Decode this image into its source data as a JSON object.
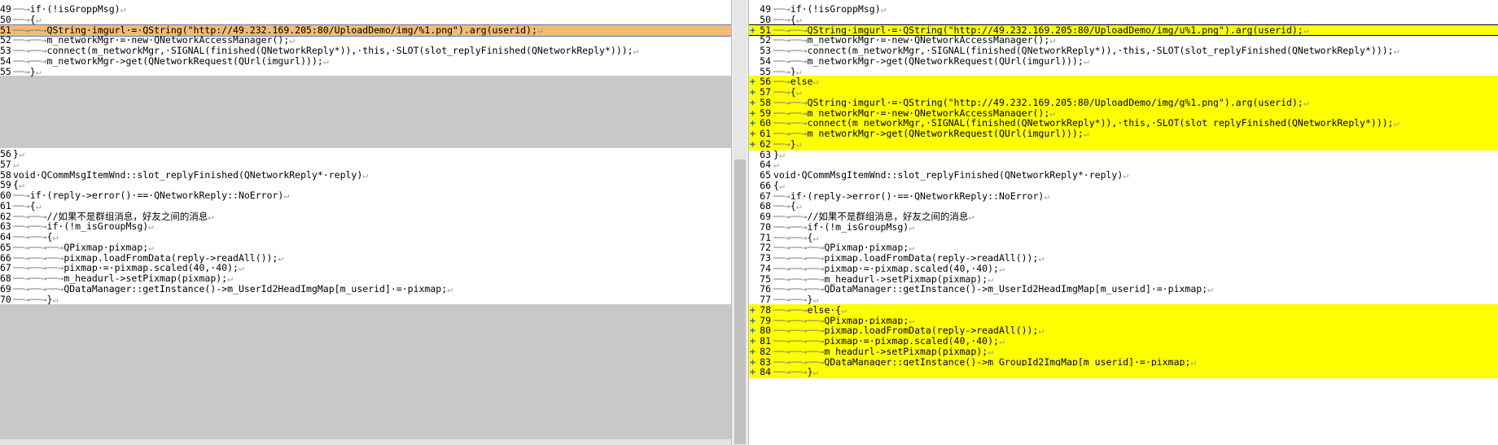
{
  "left_pane": {
    "lines": [
      {
        "num": "49",
        "fold": "──→",
        "code": "if·(!isGroppMsg)",
        "type": "normal"
      },
      {
        "num": "50",
        "fold": "──→",
        "code": "{",
        "type": "normal"
      },
      {
        "num": "51",
        "fold": "──→──→",
        "code": "QString·imgurl·=·QString(\"http://49.232.169.205:80/UploadDemo/img/%1.png\").arg(userid);",
        "type": "current"
      },
      {
        "num": "52",
        "fold": "──→──→",
        "code": "m_networkMgr·=·new·QNetworkAccessManager();",
        "type": "normal"
      },
      {
        "num": "53",
        "fold": "──→──→",
        "code": "connect(m_networkMgr,·SIGNAL(finished(QNetworkReply*)),·this,·SLOT(slot_replyFinished(QNetworkReply*)));",
        "type": "normal"
      },
      {
        "num": "54",
        "fold": "──→──→",
        "code": "m_networkMgr->get(QNetworkRequest(QUrl(imgurl)));",
        "type": "normal"
      },
      {
        "num": "55",
        "fold": "──→",
        "code": "}",
        "type": "normal"
      },
      {
        "num": "56",
        "fold": "",
        "code": "}",
        "type": "normal"
      },
      {
        "num": "57",
        "fold": "",
        "code": "",
        "type": "normal"
      },
      {
        "num": "58",
        "fold": "",
        "code": "void·QCommMsgItemWnd::slot_replyFinished(QNetworkReply*·reply)",
        "type": "normal"
      },
      {
        "num": "59",
        "fold": "",
        "code": "{",
        "type": "normal"
      },
      {
        "num": "60",
        "fold": "──→",
        "code": "if·(reply->error()·==·QNetworkReply::NoError)",
        "type": "normal"
      },
      {
        "num": "61",
        "fold": "──→",
        "code": "{",
        "type": "normal"
      },
      {
        "num": "62",
        "fold": "──→──→",
        "code": "//如果不是群组消息，好友之间的消息",
        "type": "normal"
      },
      {
        "num": "63",
        "fold": "──→──→",
        "code": "if·(!m_isGroupMsg)",
        "type": "normal"
      },
      {
        "num": "64",
        "fold": "──→──→",
        "code": "{",
        "type": "normal"
      },
      {
        "num": "65",
        "fold": "──→──→──→",
        "code": "QPixmap·pixmap;",
        "type": "normal"
      },
      {
        "num": "66",
        "fold": "──→──→──→",
        "code": "pixmap.loadFromData(reply->readAll());",
        "type": "normal"
      },
      {
        "num": "67",
        "fold": "──→──→──→",
        "code": "pixmap·=·pixmap.scaled(40,·40);",
        "type": "normal"
      },
      {
        "num": "68",
        "fold": "──→──→──→",
        "code": "m_headurl->setPixmap(pixmap);",
        "type": "normal"
      },
      {
        "num": "69",
        "fold": "──→──→──→",
        "code": "QDataManager::getInstance()->m_UserId2HeadImgMap[m_userid]·=·pixmap;",
        "type": "normal"
      },
      {
        "num": "70",
        "fold": "──→──→",
        "code": "}",
        "type": "normal"
      }
    ]
  },
  "right_pane": {
    "lines": [
      {
        "num": "49",
        "fold": "──→",
        "code": "if·(!isGroppMsg)",
        "type": "normal",
        "marker": ""
      },
      {
        "num": "50",
        "fold": "──→",
        "code": "{",
        "type": "normal",
        "marker": ""
      },
      {
        "num": "51",
        "fold": "──→──→",
        "code": "QString·imgurl·=·QString(\"http://49.232.169.205:80/UploadDemo/img/u%1.png\").arg(userid);",
        "type": "current",
        "marker": "+"
      },
      {
        "num": "52",
        "fold": "──→──→",
        "code": "m_networkMgr·=·new·QNetworkAccessManager();",
        "type": "normal",
        "marker": ""
      },
      {
        "num": "53",
        "fold": "──→──→",
        "code": "connect(m_networkMgr,·SIGNAL(finished(QNetworkReply*)),·this,·SLOT(slot_replyFinished(QNetworkReply*)));",
        "type": "normal",
        "marker": ""
      },
      {
        "num": "54",
        "fold": "──→──→",
        "code": "m_networkMgr->get(QNetworkRequest(QUrl(imgurl)));",
        "type": "normal",
        "marker": ""
      },
      {
        "num": "55",
        "fold": "──→",
        "code": "}",
        "type": "normal",
        "marker": ""
      },
      {
        "num": "56",
        "fold": "──→",
        "code": "else",
        "type": "added",
        "marker": "+"
      },
      {
        "num": "57",
        "fold": "──→",
        "code": "{",
        "type": "added",
        "marker": "+"
      },
      {
        "num": "58",
        "fold": "──→──→",
        "code": "QString·imgurl·=·QString(\"http://49.232.169.205:80/UploadDemo/img/g%1.png\").arg(userid);",
        "type": "added",
        "marker": "+"
      },
      {
        "num": "59",
        "fold": "──→──→",
        "code": "m_networkMgr·=·new·QNetworkAccessManager();",
        "type": "added",
        "marker": "+"
      },
      {
        "num": "60",
        "fold": "──→──→",
        "code": "connect(m_networkMgr,·SIGNAL(finished(QNetworkReply*)),·this,·SLOT(slot_replyFinished(QNetworkReply*)));",
        "type": "added",
        "marker": "+"
      },
      {
        "num": "61",
        "fold": "──→──→",
        "code": "m_networkMgr->get(QNetworkRequest(QUrl(imgurl)));",
        "type": "added",
        "marker": "+"
      },
      {
        "num": "62",
        "fold": "──→",
        "code": "}",
        "type": "added",
        "marker": "+"
      },
      {
        "num": "63",
        "fold": "",
        "code": "}",
        "type": "normal",
        "marker": ""
      },
      {
        "num": "64",
        "fold": "",
        "code": "",
        "type": "normal",
        "marker": ""
      },
      {
        "num": "65",
        "fold": "",
        "code": "void·QCommMsgItemWnd::slot_replyFinished(QNetworkReply*·reply)",
        "type": "normal",
        "marker": ""
      },
      {
        "num": "66",
        "fold": "",
        "code": "{",
        "type": "normal",
        "marker": ""
      },
      {
        "num": "67",
        "fold": "──→",
        "code": "if·(reply->error()·==·QNetworkReply::NoError)",
        "type": "normal",
        "marker": ""
      },
      {
        "num": "68",
        "fold": "──→",
        "code": "{",
        "type": "normal",
        "marker": ""
      },
      {
        "num": "69",
        "fold": "──→──→",
        "code": "//如果不是群组消息，好友之间的消息",
        "type": "normal",
        "marker": ""
      },
      {
        "num": "70",
        "fold": "──→──→",
        "code": "if·(!m_isGroupMsg)",
        "type": "normal",
        "marker": ""
      },
      {
        "num": "71",
        "fold": "──→──→",
        "code": "{",
        "type": "normal",
        "marker": ""
      },
      {
        "num": "72",
        "fold": "──→──→──→",
        "code": "QPixmap·pixmap;",
        "type": "normal",
        "marker": ""
      },
      {
        "num": "73",
        "fold": "──→──→──→",
        "code": "pixmap.loadFromData(reply->readAll());",
        "type": "normal",
        "marker": ""
      },
      {
        "num": "74",
        "fold": "──→──→──→",
        "code": "pixmap·=·pixmap.scaled(40,·40);",
        "type": "normal",
        "marker": ""
      },
      {
        "num": "75",
        "fold": "──→──→──→",
        "code": "m_headurl->setPixmap(pixmap);",
        "type": "normal",
        "marker": ""
      },
      {
        "num": "76",
        "fold": "──→──→──→",
        "code": "QDataManager::getInstance()->m_UserId2HeadImgMap[m_userid]·=·pixmap;",
        "type": "normal",
        "marker": ""
      },
      {
        "num": "77",
        "fold": "──→──→",
        "code": "}",
        "type": "normal",
        "marker": ""
      },
      {
        "num": "78",
        "fold": "──→──→",
        "code": "else·{",
        "type": "added",
        "marker": "+"
      },
      {
        "num": "79",
        "fold": "──→──→──→",
        "code": "QPixmap·pixmap;",
        "type": "added",
        "marker": "+"
      },
      {
        "num": "80",
        "fold": "──→──→──→",
        "code": "pixmap.loadFromData(reply->readAll());",
        "type": "added",
        "marker": "+"
      },
      {
        "num": "81",
        "fold": "──→──→──→",
        "code": "pixmap·=·pixmap.scaled(40,·40);",
        "type": "added",
        "marker": "+"
      },
      {
        "num": "82",
        "fold": "──→──→──→",
        "code": "m_headurl->setPixmap(pixmap);",
        "type": "added",
        "marker": "+"
      },
      {
        "num": "83",
        "fold": "──→──→──→",
        "code": "QDataManager::getInstance()->m_GroupId2ImgMap[m_userid]·=·pixmap;",
        "type": "added",
        "marker": "+"
      },
      {
        "num": "84",
        "fold": "──→──→",
        "code": "}",
        "type": "added",
        "marker": "+"
      }
    ]
  },
  "colors": {
    "added_highlight": "#ffff00",
    "current_left": "#f2bb74",
    "gap_fill": "#c8c8c8",
    "change_marker": "#2e6db4"
  },
  "glyphs": {
    "pilcrow": "↵"
  }
}
